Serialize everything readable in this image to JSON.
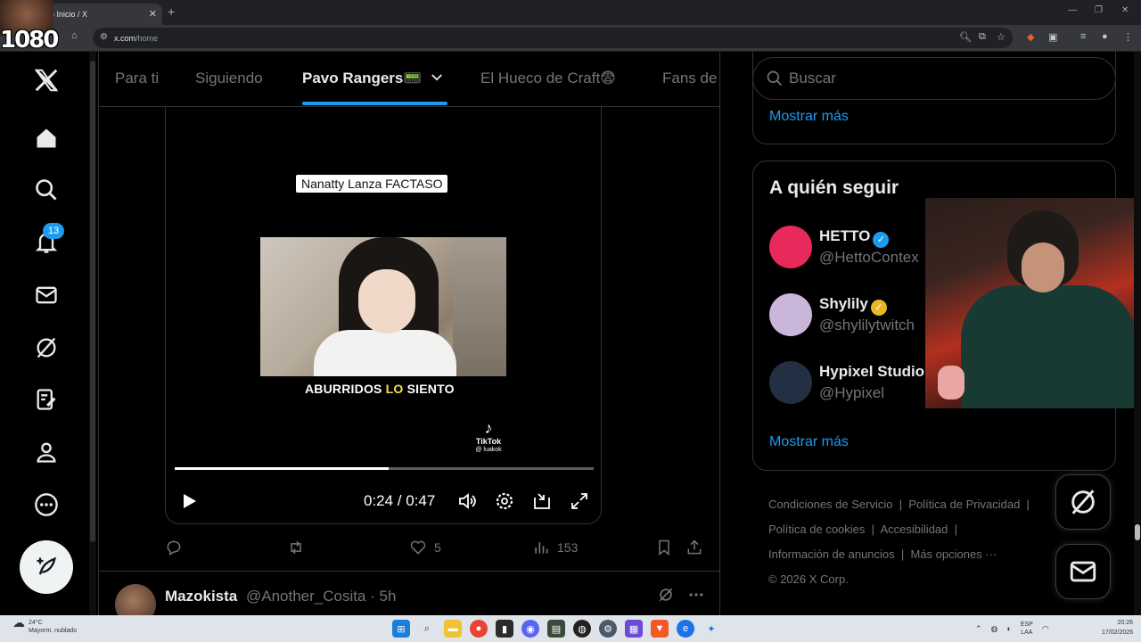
{
  "browser": {
    "tab_title": ") Inicio / X",
    "tab_close": "✕",
    "new_tab": "+",
    "url_host": "x.com",
    "url_path": "/home",
    "window_controls": [
      "—",
      "❐",
      "✕"
    ]
  },
  "overlay": {
    "resolution_tag": "1080"
  },
  "sidebar": {
    "items": [
      {
        "name": "x-logo-icon"
      },
      {
        "name": "home-icon"
      },
      {
        "name": "explore-icon"
      },
      {
        "name": "notifications-icon"
      },
      {
        "name": "messages-icon"
      },
      {
        "name": "grok-icon"
      },
      {
        "name": "lists-icon"
      },
      {
        "name": "profile-icon"
      },
      {
        "name": "more-icon"
      }
    ],
    "notification_count": "13",
    "post_button_icon": "feather-plus-icon"
  },
  "feed_tabs": [
    {
      "label": "Para ti"
    },
    {
      "label": "Siguiendo"
    },
    {
      "label": "Pavo Rangers📟"
    },
    {
      "label": "El Hueco de Craft😨"
    },
    {
      "label": "Fans de"
    }
  ],
  "video": {
    "caption": "Nanatty Lanza FACTASO",
    "subtitle_a": "ABURRIDOS ",
    "subtitle_hl": "LO",
    "subtitle_b": " SIENTO",
    "tiktok_label": "TikTok",
    "tiktok_handle": "@ luakok",
    "time": "0:24 / 0:47",
    "progress": 0.51
  },
  "post_actions": {
    "likes": "5",
    "views": "153"
  },
  "next_post": {
    "name": "Mazokista",
    "handle": "@Another_Cosita · 5h"
  },
  "right": {
    "search_placeholder": "Buscar",
    "show_more_1": "Mostrar más",
    "who_to_follow_title": "A quién seguir",
    "suggestions": [
      {
        "name": "HETTO",
        "handle": "@HettoContex",
        "badge_color": "#1d9bf0",
        "avatar_color": "#e8295c"
      },
      {
        "name": "Shylily",
        "handle": "@shylilytwitch",
        "badge_color": "#e8b923",
        "avatar_color": "#c9b6d9"
      },
      {
        "name": "Hypixel Studio",
        "handle": "@Hypixel",
        "badge_color": "#1d9bf0",
        "avatar_color": "#233044"
      }
    ],
    "show_more_2": "Mostrar más",
    "footer": {
      "terms": "Condiciones de Servicio",
      "privacy": "Política de Privacidad",
      "cookies": "Política de cookies",
      "accessibility": "Accesibilidad",
      "ads": "Información de anuncios",
      "more": "Más opciones ···",
      "copyright": "© 2026 X Corp."
    }
  },
  "taskbar": {
    "temp": "24°C",
    "weather": "Mayorm. nublado",
    "lang_top": "ESP",
    "lang_bottom": "LAA",
    "time": "20:26",
    "date": "17/02/2026"
  },
  "colors": {
    "accent": "#1d9bf0",
    "text": "#e7e9ea",
    "muted": "#71767b",
    "border": "#2f3336"
  }
}
